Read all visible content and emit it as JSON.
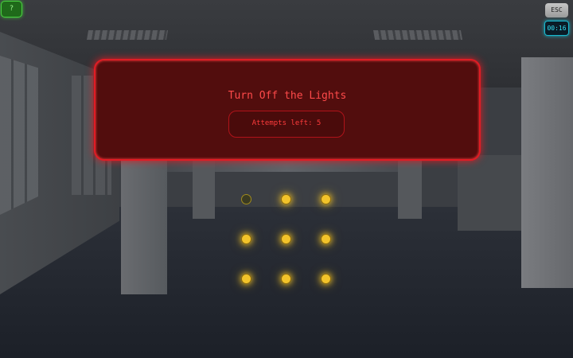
{
  "hud": {
    "help_label": "?",
    "esc_label": "ESC",
    "timer": "00:16"
  },
  "dialog": {
    "title": "Turn Off the Lights",
    "attempts": "Attempts left: 5"
  },
  "grid": {
    "rows": 3,
    "cols": 3,
    "lights": [
      [
        false,
        true,
        true
      ],
      [
        true,
        true,
        true
      ],
      [
        true,
        true,
        true
      ]
    ]
  },
  "colors": {
    "panel_bg": "#520d0d",
    "panel_border": "#e01c24",
    "light_on": "#f2c32a",
    "help_green": "#48d040",
    "timer_cyan": "#34e1f5"
  }
}
